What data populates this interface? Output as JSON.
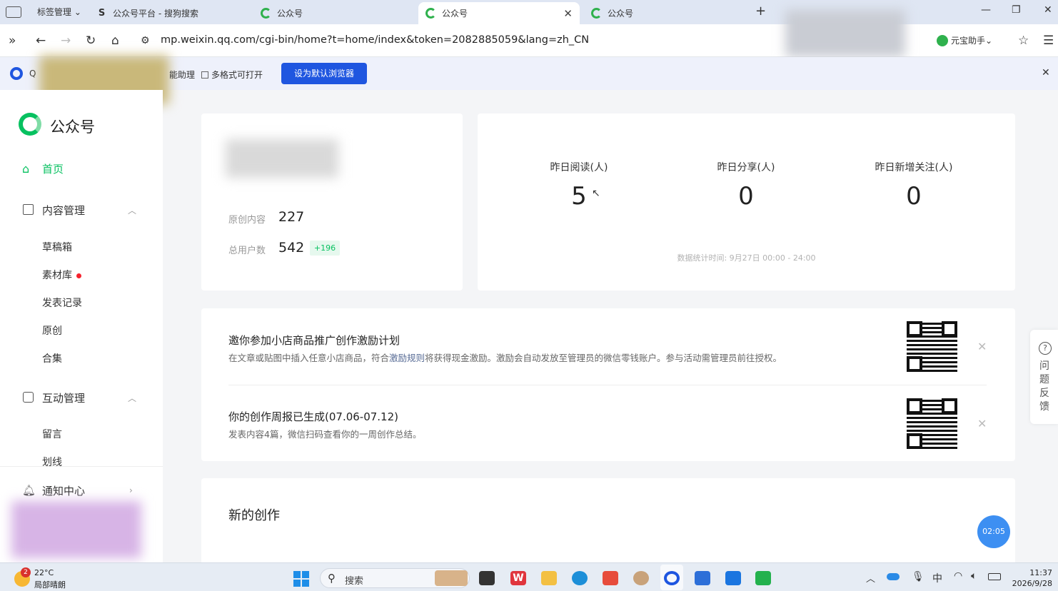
{
  "browser": {
    "tab_group_label": "标签管理",
    "tabs": [
      {
        "title": "公众号平台 - 搜狗搜索"
      },
      {
        "title": "公众号"
      },
      {
        "title": "公众号",
        "active": true
      },
      {
        "title": "公众号"
      }
    ],
    "url": "mp.weixin.qq.com/cgi-bin/home?t=home/index&token=2082885059&lang=zh_CN",
    "assistant_label": "元宝助手"
  },
  "infobar": {
    "helper_text": "能助理",
    "checkbox_label": "多格式可打开",
    "default_button": "设为默认浏览器"
  },
  "sidebar": {
    "logo_text": "公众号",
    "home": "首页",
    "content_mgmt": "内容管理",
    "content_items": [
      "草稿箱",
      "素材库",
      "发表记录",
      "原创",
      "合集"
    ],
    "interaction_mgmt": "互动管理",
    "interaction_items": [
      "留言",
      "划线"
    ],
    "notification": "通知中心"
  },
  "account": {
    "original_label": "原创内容",
    "original_value": "227",
    "users_label": "总用户数",
    "users_value": "542",
    "users_delta": "+196"
  },
  "stats": {
    "items": [
      {
        "label": "昨日阅读(人)",
        "value": "5"
      },
      {
        "label": "昨日分享(人)",
        "value": "0"
      },
      {
        "label": "昨日新增关注(人)",
        "value": "0"
      }
    ],
    "stat_time": "数据统计时间: 9月27日 00:00 - 24:00"
  },
  "notices": [
    {
      "title": "邀你参加小店商品推广创作激励计划",
      "desc_before": "在文章或贴图中插入任意小店商品，符合",
      "desc_link": "激励规则",
      "desc_after": "将获得现金激励。激励会自动发放至管理员的微信零钱账户。参与活动需管理员前往授权。"
    },
    {
      "title": "你的创作周报已生成(07.06-07.12)",
      "desc": "发表内容4篇，微信扫码查看你的一周创作总结。"
    }
  ],
  "new_creation": "新的创作",
  "feedback": "问题反馈",
  "timer": "02:05",
  "taskbar": {
    "weather_temp": "22°C",
    "weather_desc": "局部晴朗",
    "weather_badge": "2",
    "search": "搜索",
    "ime": "中",
    "time": "11:37",
    "date": "2026/9/28"
  },
  "colors": {
    "accent_green": "#07c160",
    "brand_blue": "#1f56e0",
    "link": "#576b95"
  }
}
